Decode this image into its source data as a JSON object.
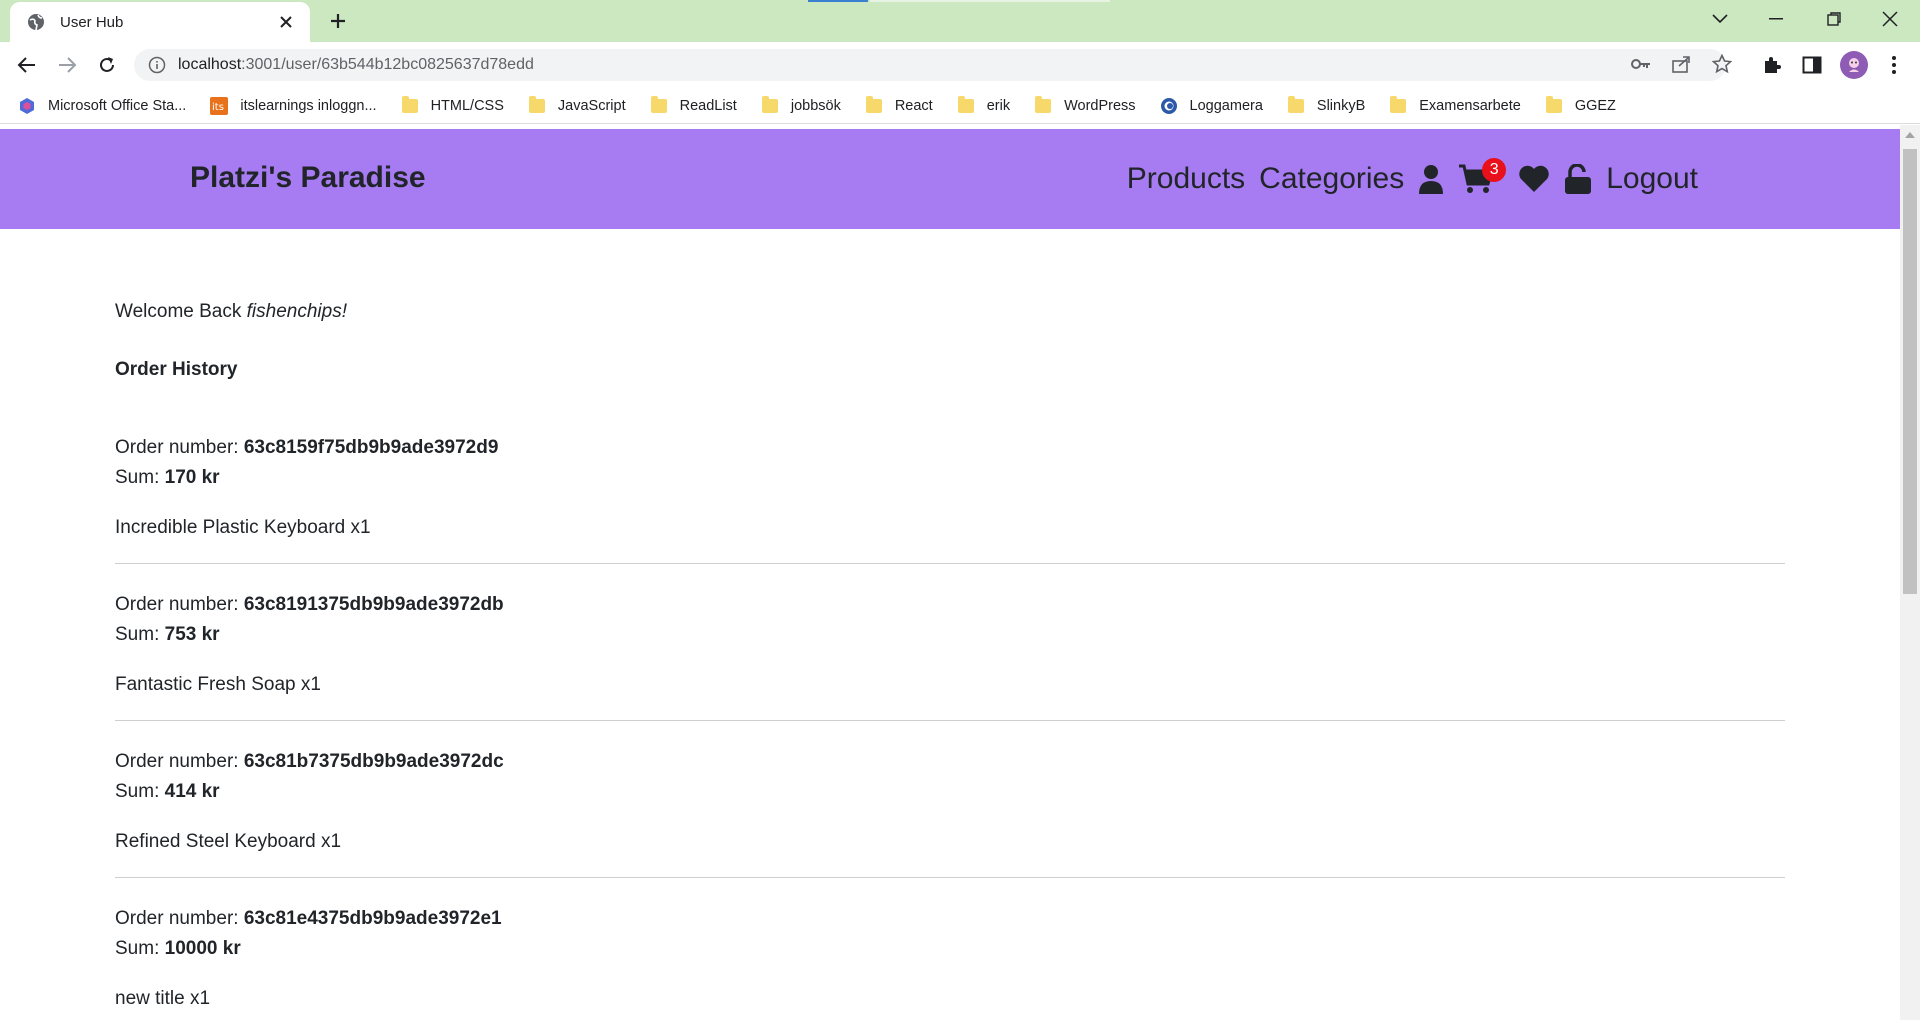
{
  "browser": {
    "tab_title": "User Hub",
    "url_host": "localhost",
    "url_rest": ":3001/user/63b544b12bc0825637d78edd",
    "bookmarks": [
      {
        "label": "Microsoft Office Sta...",
        "icon": "office-icon"
      },
      {
        "label": "itslearnings inloggn...",
        "icon": "its-icon"
      },
      {
        "label": "HTML/CSS",
        "icon": "folder-icon"
      },
      {
        "label": "JavaScript",
        "icon": "folder-icon"
      },
      {
        "label": "ReadList",
        "icon": "folder-icon"
      },
      {
        "label": "jobbsök",
        "icon": "folder-icon"
      },
      {
        "label": "React",
        "icon": "folder-icon"
      },
      {
        "label": "erik",
        "icon": "folder-icon"
      },
      {
        "label": "WordPress",
        "icon": "folder-icon"
      },
      {
        "label": "Loggamera",
        "icon": "loggamera-icon"
      },
      {
        "label": "SlinkyB",
        "icon": "folder-icon"
      },
      {
        "label": "Examensarbete",
        "icon": "folder-icon"
      },
      {
        "label": "GGEZ",
        "icon": "folder-icon"
      }
    ]
  },
  "site": {
    "brand": "Platzi's Paradise",
    "nav": {
      "products": "Products",
      "categories": "Categories",
      "cart_count": "3",
      "logout": "Logout"
    },
    "accent_color": "#a77cf2"
  },
  "page": {
    "welcome_prefix": "Welcome Back",
    "username": "fishenchips!",
    "history_title": "Order History",
    "order_number_label": "Order number:",
    "sum_label": "Sum:",
    "orders": [
      {
        "number": "63c8159f75db9b9ade3972d9",
        "sum": "170 kr",
        "item": "Incredible Plastic Keyboard x1"
      },
      {
        "number": "63c8191375db9b9ade3972db",
        "sum": "753 kr",
        "item": "Fantastic Fresh Soap x1"
      },
      {
        "number": "63c81b7375db9b9ade3972dc",
        "sum": "414 kr",
        "item": "Refined Steel Keyboard x1"
      },
      {
        "number": "63c81e4375db9b9ade3972e1",
        "sum": "10000 kr",
        "item": "new title x1"
      }
    ]
  }
}
